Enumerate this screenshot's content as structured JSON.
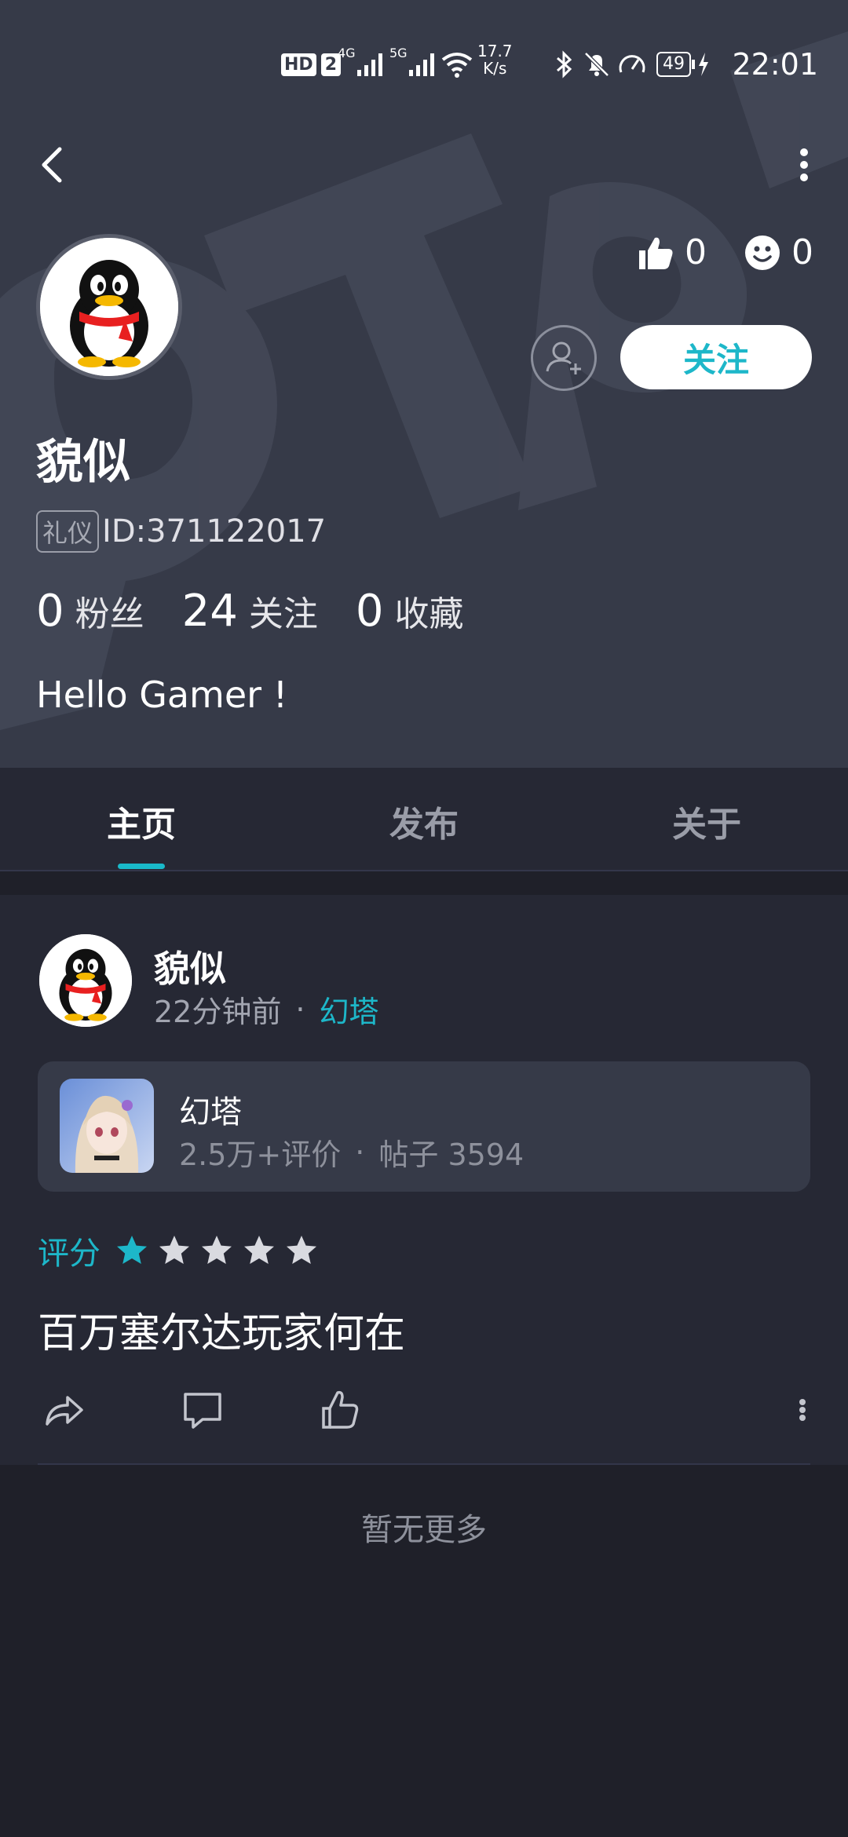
{
  "status_bar": {
    "time": "22:01",
    "speed_value": "17.7",
    "speed_unit": "K/s",
    "battery": "49",
    "hd_badge": "HD",
    "sim_number": "2",
    "signal1_label": "4G",
    "signal2_label": "5G"
  },
  "profile": {
    "name": "貌似",
    "id_badge": "礼仪",
    "id_text": "ID:371122017",
    "likes_count": "0",
    "emoji_count": "0",
    "follow_label": "关注",
    "bio": "Hello Gamer !",
    "counts": [
      {
        "num": "0",
        "label": "粉丝"
      },
      {
        "num": "24",
        "label": "关注"
      },
      {
        "num": "0",
        "label": "收藏"
      }
    ]
  },
  "tabs": [
    {
      "label": "主页",
      "active": true
    },
    {
      "label": "发布",
      "active": false
    },
    {
      "label": "关于",
      "active": false
    }
  ],
  "post": {
    "author": "貌似",
    "time_ago": "22分钟前",
    "separator": "·",
    "game_tag": "幻塔",
    "game_card": {
      "title": "幻塔",
      "reviews": "2.5万+评价",
      "separator": "·",
      "posts": "帖子 3594"
    },
    "rating_label": "评分",
    "rating": 1,
    "rating_max": 5,
    "text": "百万塞尔达玩家何在"
  },
  "footer": {
    "no_more": "暂无更多"
  },
  "colors": {
    "accent": "#1db7c9",
    "header_bg": "#363a48",
    "page_bg": "#1f2029",
    "card_bg": "#262834"
  },
  "icons": {
    "back": "chevron-left-icon",
    "more": "more-vertical-icon",
    "like": "thumbs-up-icon",
    "emoji": "smile-icon",
    "add_friend": "user-plus-icon",
    "share": "share-icon",
    "comment": "comment-icon",
    "post_like": "thumbs-up-outline-icon",
    "post_more": "more-vertical-icon"
  }
}
